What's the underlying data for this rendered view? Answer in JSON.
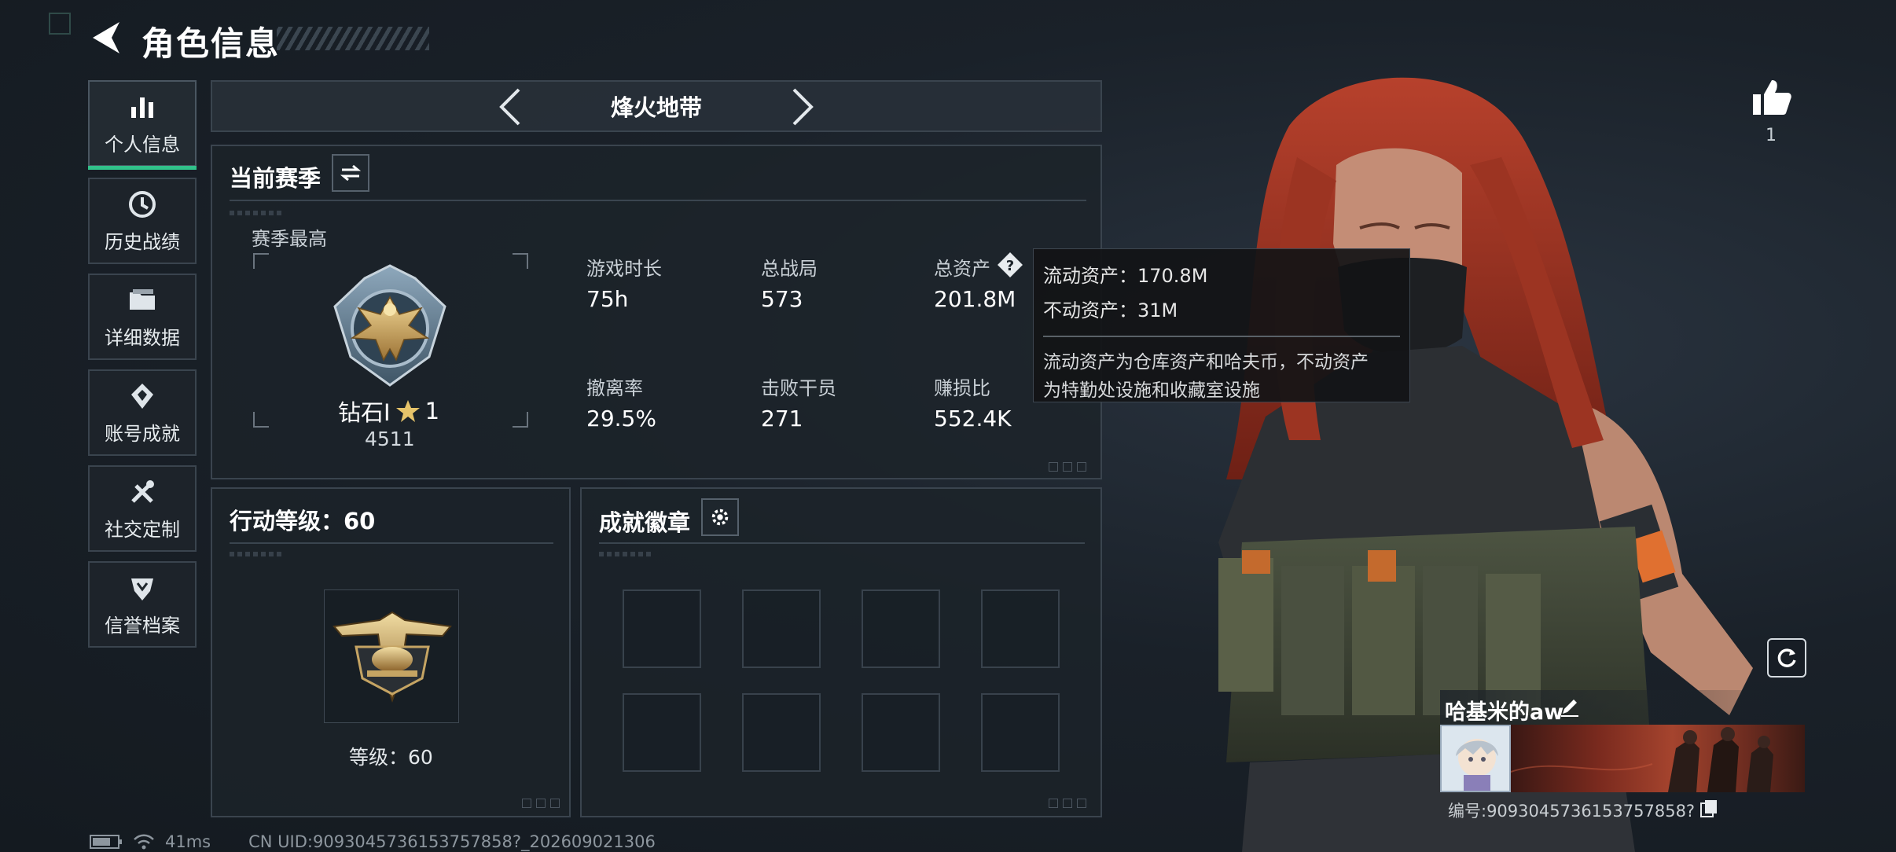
{
  "header": {
    "title": "角色信息"
  },
  "sidebar": {
    "items": [
      {
        "label": "个人信息",
        "icon": "bar-chart-icon",
        "active": true
      },
      {
        "label": "历史战绩",
        "icon": "history-clock-icon"
      },
      {
        "label": "详细数据",
        "icon": "folder-icon"
      },
      {
        "label": "账号成就",
        "icon": "achievement-icon"
      },
      {
        "label": "社交定制",
        "icon": "tools-icon"
      },
      {
        "label": "信誉档案",
        "icon": "credit-shield-icon"
      }
    ]
  },
  "map_selector": {
    "name": "烽火地带"
  },
  "season": {
    "title": "当前赛季",
    "peak_label": "赛季最高",
    "rank_name": "钻石I",
    "rank_stars": "1",
    "rank_points": "4511",
    "stats": [
      {
        "label": "游戏时长",
        "value": "75h"
      },
      {
        "label": "总战局",
        "value": "573"
      },
      {
        "label": "总资产",
        "value": "201.8M"
      },
      {
        "label": "撤离率",
        "value": "29.5%"
      },
      {
        "label": "击败干员",
        "value": "271"
      },
      {
        "label": "赚损比",
        "value": "552.4K"
      }
    ]
  },
  "tooltip": {
    "liquid": "流动资产：170.8M",
    "fixed": "不动资产：31M",
    "desc_line1": "流动资产为仓库资产和哈夫币，不动资产",
    "desc_line2": "为特勤处设施和收藏室设施"
  },
  "action_level": {
    "title": "行动等级：60",
    "level_label": "等级：60"
  },
  "badges": {
    "title": "成就徽章",
    "slots": 8
  },
  "profile": {
    "likes": "1",
    "name": "哈基米的aw",
    "id_text": "编号:9093045736153757858?"
  },
  "status": {
    "ping": "41ms",
    "uid": "CN UID:9093045736153757858?_202609021306"
  },
  "colors": {
    "accent": "#31c28a",
    "panel_border": "#3a444e",
    "gold": "#c9a35a"
  }
}
